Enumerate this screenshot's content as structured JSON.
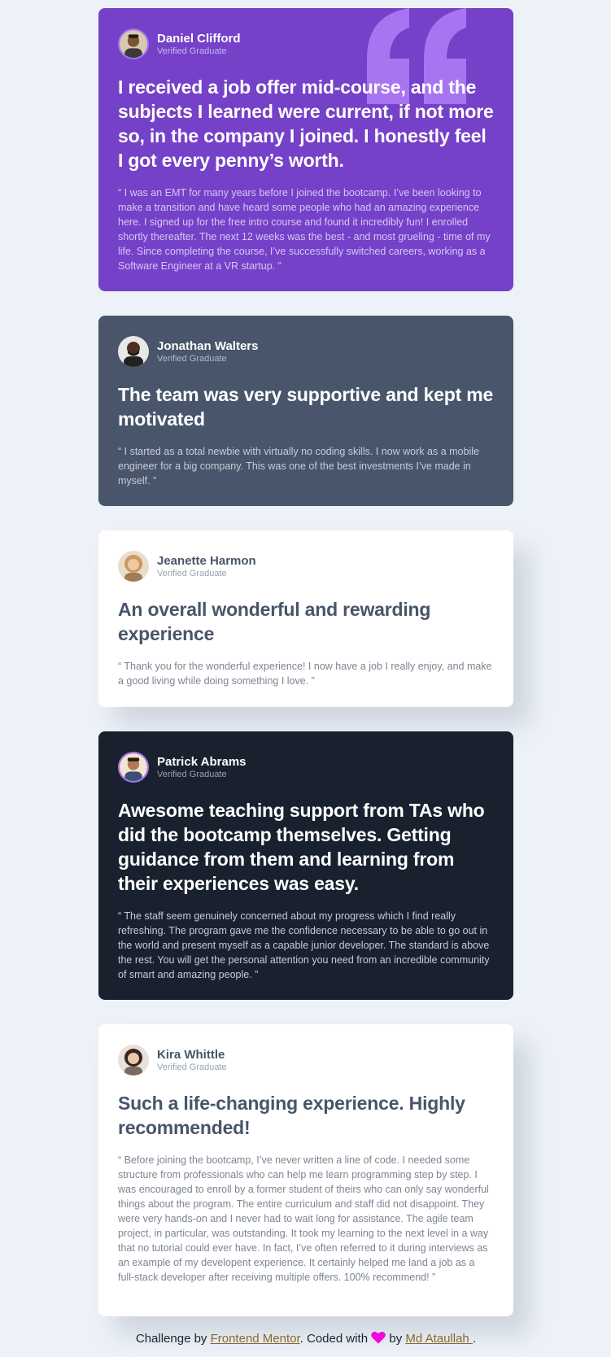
{
  "testimonials": [
    {
      "name": "Daniel Clifford",
      "role": "Verified Graduate",
      "headline": "I received a job offer mid-course, and the subjects I learned were current, if not more so, in the company I joined. I honestly feel I got every penny’s worth.",
      "body": "“ I was an EMT for many years before I joined the bootcamp. I’ve been looking to make a transition and have heard some people who had an amazing experience here. I signed up for the free intro course and found it incredibly fun! I enrolled shortly thereafter. The next 12 weeks was the best - and most grueling - time of my life. Since completing the course, I’ve successfully switched careers, working as a Software Engineer at a VR startup. ”",
      "card_color": "#7541c8"
    },
    {
      "name": "Jonathan Walters",
      "role": "Verified Graduate",
      "headline": "The team was very supportive and kept me motivated",
      "body": "“ I started as a total newbie with virtually no coding skills. I now work as a mobile engineer for a big company. This was one of the best investments I’ve made in myself. ”",
      "card_color": "#48556a"
    },
    {
      "name": "Jeanette Harmon",
      "role": "Verified Graduate",
      "headline": "An overall wonderful and rewarding experience",
      "body": "“ Thank you for the wonderful experience! I now have a job I really enjoy, and make a good living while doing something I love. ”",
      "card_color": "#ffffff"
    },
    {
      "name": "Patrick Abrams",
      "role": "Verified Graduate",
      "headline": "Awesome teaching support from TAs who did the bootcamp themselves. Getting guidance from them and learning from their experiences was easy.",
      "body": "“ The staff seem genuinely concerned about my progress which I find really refreshing. The program gave me the confidence necessary to be able to go out in the world and present myself as a capable junior developer. The standard is above the rest. You will get the personal attention you need from an incredible community of smart and amazing people. ”",
      "card_color": "#19212e"
    },
    {
      "name": "Kira Whittle",
      "role": "Verified Graduate",
      "headline": "Such a life-changing experience. Highly recommended!",
      "body": "“ Before joining the bootcamp, I’ve never written a line of code. I needed some structure from professionals who can help me learn programming step by step. I was encouraged to enroll by a former student of theirs who can only say wonderful things about the program. The entire curriculum and staff did not disappoint. They were very hands-on and I never had to wait long for assistance. The agile team project, in particular, was outstanding. It took my learning to the next level in a way that no tutorial could ever have. In fact, I’ve often referred to it during interviews as an example of my developent experience. It certainly helped me land a job as a full-stack developer after receiving multiple offers. 100% recommend! ”",
      "card_color": "#ffffff"
    }
  ],
  "attribution": {
    "prefix": "Challenge by ",
    "link1": "Frontend Mentor",
    "middle": ". Coded with ",
    "heart_icon": "heart-icon",
    "by": " by ",
    "link2": "Md Ataullah ",
    "suffix": "."
  },
  "colors": {
    "background": "#edf2f8",
    "purple": "#7541c8",
    "grayish_blue": "#48556a",
    "dark_blue": "#19212e",
    "heart": "#ff00e6",
    "link": "#8a6a2b"
  }
}
